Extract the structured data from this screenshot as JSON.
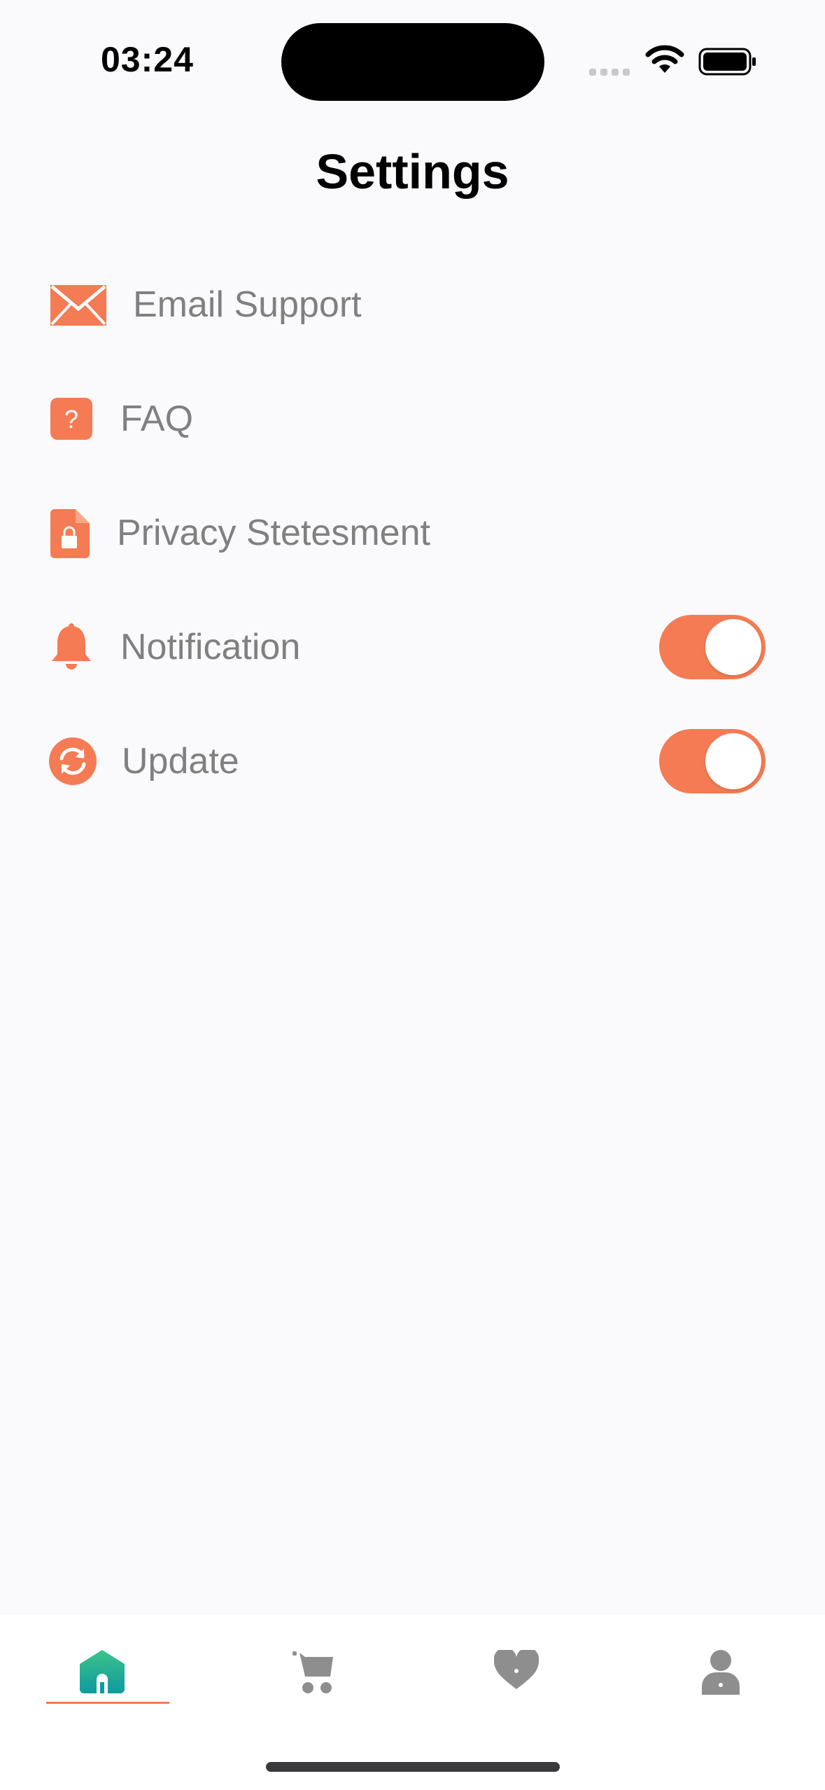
{
  "status_bar": {
    "time": "03:24"
  },
  "page": {
    "title": "Settings"
  },
  "settings": [
    {
      "label": "Email Support",
      "icon": "mail-icon"
    },
    {
      "label": "FAQ",
      "icon": "question-icon"
    },
    {
      "label": "Privacy Stetesment",
      "icon": "lock-document-icon"
    },
    {
      "label": "Notification",
      "icon": "bell-icon",
      "toggle": true
    },
    {
      "label": "Update",
      "icon": "refresh-icon",
      "toggle": true
    }
  ],
  "tabs": [
    {
      "name": "home",
      "icon": "home-icon",
      "active": true
    },
    {
      "name": "cart",
      "icon": "cart-icon",
      "active": false
    },
    {
      "name": "favorites",
      "icon": "heart-icon",
      "active": false
    },
    {
      "name": "profile",
      "icon": "user-icon",
      "active": false
    }
  ],
  "colors": {
    "accent": "#f47b53",
    "label": "#808080",
    "tab_inactive": "#8e8e8e",
    "tab_active_top": "#3ec38a",
    "tab_active_bottom": "#0e9aa0"
  }
}
